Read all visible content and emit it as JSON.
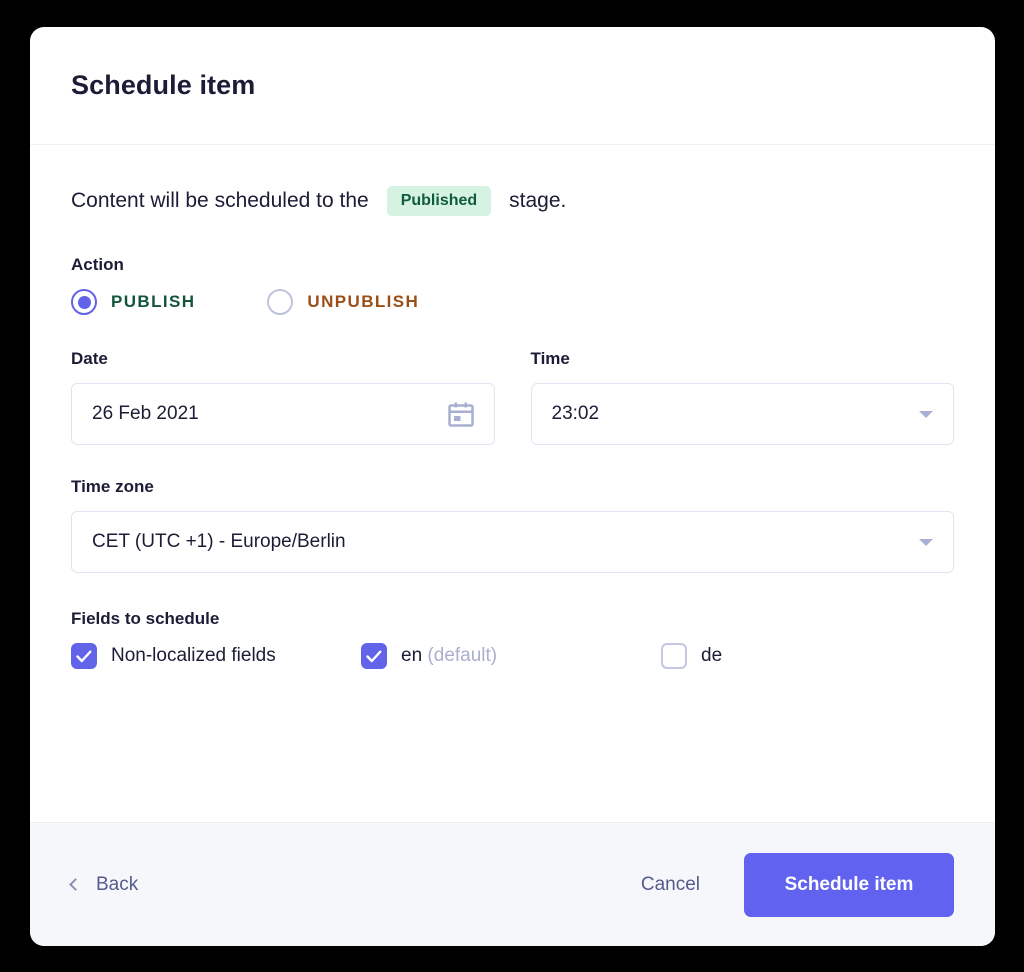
{
  "dialog": {
    "title": "Schedule item",
    "intro": {
      "prefix": "Content will be scheduled to the",
      "badge": "Published",
      "suffix": "stage."
    },
    "action": {
      "label": "Action",
      "options": [
        {
          "label": "PUBLISH",
          "selected": true
        },
        {
          "label": "UNPUBLISH",
          "selected": false
        }
      ]
    },
    "date": {
      "label": "Date",
      "value": "26 Feb 2021",
      "icon": "calendar-icon"
    },
    "time": {
      "label": "Time",
      "value": "23:02",
      "icon": "chevron-down-icon"
    },
    "timezone": {
      "label": "Time zone",
      "value": "CET (UTC +1) - Europe/Berlin",
      "icon": "chevron-down-icon"
    },
    "fields": {
      "label": "Fields to schedule",
      "items": [
        {
          "label": "Non-localized fields",
          "sub": "",
          "checked": true
        },
        {
          "label": "en",
          "sub": "(default)",
          "checked": true
        },
        {
          "label": "de",
          "sub": "",
          "checked": false
        }
      ]
    },
    "footer": {
      "back_label": "Back",
      "cancel_label": "Cancel",
      "submit_label": "Schedule item"
    }
  },
  "colors": {
    "accent": "#6163f0",
    "badge_bg": "#d6f2e3",
    "badge_text": "#0f5c3f",
    "publish_text": "#14563c",
    "unpublish_text": "#9a4f17",
    "text": "#1b1d36",
    "muted": "#555b8c",
    "border": "#e2e5f1",
    "footer_bg": "#f6f7fa"
  }
}
